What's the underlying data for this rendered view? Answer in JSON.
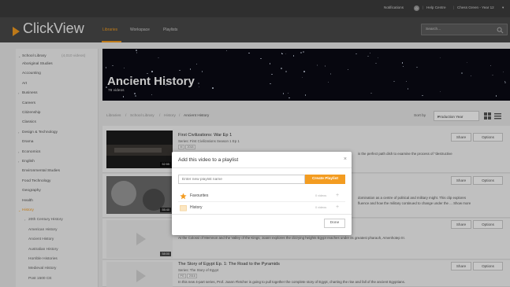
{
  "utility_bar": {
    "notifications": "Notifications",
    "notifications_count": "0",
    "help": "Help Centre",
    "user": "Chess Green - Year 12",
    "user_caret": "▾"
  },
  "header": {
    "logo": "ClickView",
    "nav": [
      "Libraries",
      "Workspace",
      "Playlists"
    ],
    "search_placeholder": "Search..."
  },
  "sidebar": {
    "library": "School Library",
    "library_count": "(4,010 videos)",
    "items": [
      {
        "label": "Aboriginal Studies",
        "caret": ""
      },
      {
        "label": "Accounting",
        "caret": ""
      },
      {
        "label": "Art",
        "caret": ""
      },
      {
        "label": "Business",
        "caret": "›"
      },
      {
        "label": "Careers",
        "caret": ""
      },
      {
        "label": "Citizenship",
        "caret": ""
      },
      {
        "label": "Classics",
        "caret": ""
      },
      {
        "label": "Design & Technology",
        "caret": "›"
      },
      {
        "label": "Drama",
        "caret": ""
      },
      {
        "label": "Economics",
        "caret": "›"
      },
      {
        "label": "English",
        "caret": "›"
      },
      {
        "label": "Environmental Studies",
        "caret": ""
      },
      {
        "label": "Food Technology",
        "caret": ""
      },
      {
        "label": "Geography",
        "caret": ""
      },
      {
        "label": "Health",
        "caret": ""
      },
      {
        "label": "History",
        "caret": "⌄"
      },
      {
        "label": "20th Century History",
        "caret": "›"
      },
      {
        "label": "American History",
        "caret": ""
      },
      {
        "label": "Ancient History",
        "caret": ""
      },
      {
        "label": "Australian History",
        "caret": ""
      },
      {
        "label": "Horrible Histories",
        "caret": ""
      },
      {
        "label": "Medieval History",
        "caret": ""
      },
      {
        "label": "Post 1500 CE",
        "caret": ""
      }
    ]
  },
  "hero": {
    "title": "Ancient History",
    "count": "78 videos"
  },
  "breadcrumb": [
    "Libraries",
    "School Library",
    "History",
    "Ancient History"
  ],
  "breadcrumb_sep": "/",
  "sort": {
    "label": "Sort by",
    "value": "Production Year",
    "caret": "▾"
  },
  "rows": [
    {
      "title": "First Civilizations: War Ep 1",
      "series": "Series: First Civilizations Season 1 Ep 1",
      "tags": [
        "M",
        "2018"
      ],
      "desc": "is the perfect path dish to examine the process of \"destructive",
      "duration": "52:55",
      "share": "Share",
      "options": "Options"
    },
    {
      "title": "",
      "series": "",
      "tags": [],
      "desc": "domination as a centre of political and military might. This clip explores",
      "desc2": "fluence and how the military continued to change under the ... Show more",
      "duration": "55:40",
      "share": "Share",
      "options": "Options"
    },
    {
      "title": "",
      "series": "",
      "tags": [],
      "desc": "At the Colossi of Memnon and the Valley of the Kings, Joann explores the dizzying heights Egypt reaches under its greatest pharaoh, Amenhotep III.",
      "duration": "58:00",
      "share": "Share",
      "options": "Options"
    },
    {
      "title": "The Story of Egypt Ep. 1: The Road to the Pyramids",
      "series": "Series: The Story of Egypt",
      "tags": [
        "PG",
        "2016"
      ],
      "desc": "In this new 4-part series, Prof. Joann Fletcher is going to pull together the complete story of Egypt, charting the rise and fall of the ancient Egyptians.",
      "duration": "",
      "share": "Share",
      "options": "Options"
    }
  ],
  "modal": {
    "title": "Add this video to a playlist",
    "close": "×",
    "input_placeholder": "Enter new playlist name",
    "create_label": "Create Playlist",
    "playlists": [
      {
        "name": "Favourites",
        "count": "0 videos",
        "icon": "star-icon"
      },
      {
        "name": "History",
        "count": "0 videos",
        "icon": "folder-icon"
      }
    ],
    "add_symbol": "+",
    "done_label": "Done"
  },
  "colors": {
    "accent": "#f39c21",
    "header": "#4a4a4a",
    "utility": "#3d3d3d"
  }
}
